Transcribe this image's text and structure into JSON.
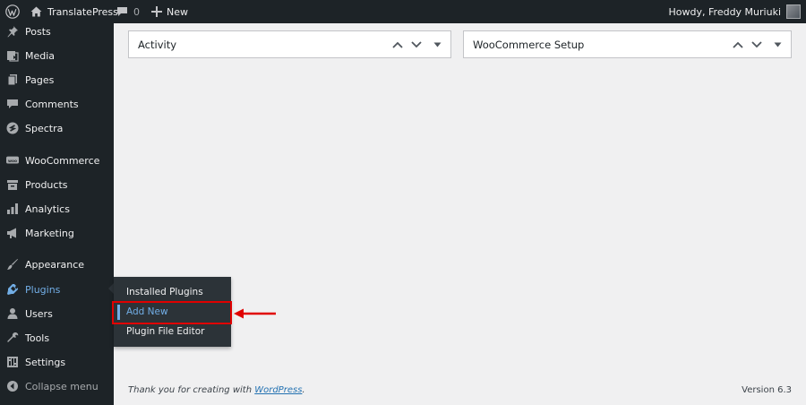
{
  "admin_bar": {
    "site_name": "TranslatePress",
    "comments_count": "0",
    "new_label": "New",
    "greeting": "Howdy, Freddy Muriuki"
  },
  "sidebar": {
    "items": [
      {
        "label": "Posts",
        "icon": "pin-icon"
      },
      {
        "label": "Media",
        "icon": "media-icon"
      },
      {
        "label": "Pages",
        "icon": "pages-icon"
      },
      {
        "label": "Comments",
        "icon": "comments-icon"
      },
      {
        "label": "Spectra",
        "icon": "spectra-icon"
      },
      {
        "label": "WooCommerce",
        "icon": "woocommerce-icon"
      },
      {
        "label": "Products",
        "icon": "products-icon"
      },
      {
        "label": "Analytics",
        "icon": "analytics-icon"
      },
      {
        "label": "Marketing",
        "icon": "megaphone-icon"
      },
      {
        "label": "Appearance",
        "icon": "paintbrush-icon"
      },
      {
        "label": "Plugins",
        "icon": "plugin-icon"
      },
      {
        "label": "Users",
        "icon": "users-icon"
      },
      {
        "label": "Tools",
        "icon": "wrench-icon"
      },
      {
        "label": "Settings",
        "icon": "settings-icon"
      }
    ],
    "collapse_label": "Collapse menu",
    "active_item": "Plugins"
  },
  "plugins_flyout": {
    "items": [
      "Installed Plugins",
      "Add New",
      "Plugin File Editor"
    ]
  },
  "widgets": [
    {
      "title": "Activity"
    },
    {
      "title": "WooCommerce Setup"
    }
  ],
  "footer": {
    "thank_you_prefix": "Thank you for creating with ",
    "thank_you_link": "WordPress",
    "thank_you_suffix": ".",
    "version": "Version 6.3"
  },
  "colors": {
    "admin_dark": "#1d2327",
    "flyout_bg": "#2c3338",
    "accent_blue": "#72aee6",
    "highlight_red": "#e00000"
  }
}
